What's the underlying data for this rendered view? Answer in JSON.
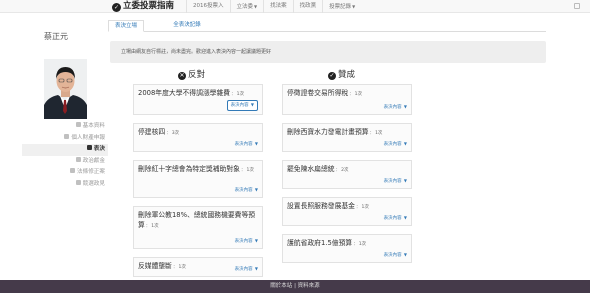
{
  "navbar": {
    "brand": "立委投票指南",
    "items": [
      {
        "label": "2016投票入",
        "caret": false
      },
      {
        "label": "立法委",
        "caret": true
      },
      {
        "label": "找法案",
        "caret": false
      },
      {
        "label": "找政黨",
        "caret": false
      },
      {
        "label": "投票記錄",
        "caret": true
      }
    ]
  },
  "sidebar": {
    "name": "蔡正元",
    "items": [
      {
        "label": "基本資料",
        "active": false
      },
      {
        "label": "個人財產申報",
        "active": false
      },
      {
        "label": "表決",
        "active": true
      },
      {
        "label": "政治獻金",
        "active": false
      },
      {
        "label": "法條修正案",
        "active": false
      },
      {
        "label": "競選政見",
        "active": false
      }
    ]
  },
  "tabs": [
    {
      "label": "表決立場",
      "active": true
    },
    {
      "label": "全表決記錄",
      "active": false
    }
  ],
  "notice": "立場由網友自行標註，尚未盡完。歡迎進入表決內容一起讓議題更好",
  "columns": {
    "oppose_label": "反對",
    "support_label": "贊成"
  },
  "oppose": [
    {
      "title": "2008年度大學不得調漲學雜費",
      "count": "1次",
      "button": "表決內容"
    },
    {
      "title": "停建核四",
      "count": "3次",
      "button": "表決內容"
    },
    {
      "title": "刪除紅十字總會為特定獎補助對象",
      "count": "1次",
      "button": "表決內容"
    },
    {
      "title": "刪除軍公教18%、總統國務機要費等預算",
      "count": "1次",
      "button": "表決內容"
    },
    {
      "title": "反媒體壟斷",
      "count": "1次",
      "button": "表決內容"
    }
  ],
  "support": [
    {
      "title": "停徵證卷交易所得稅",
      "count": "1次",
      "button": "表決內容"
    },
    {
      "title": "刪除西寶水力發電計畫預算",
      "count": "1次",
      "button": "表決內容"
    },
    {
      "title": "罷免陳水扁總統",
      "count": "2次",
      "button": "表決內容"
    },
    {
      "title": "設置長照服務發展基金",
      "count": "1次",
      "button": "表決內容"
    },
    {
      "title": "護航省政府1.5億預算",
      "count": "1次",
      "button": "表決內容"
    }
  ],
  "footer": {
    "left": "關於本站",
    "right": "資料來源"
  }
}
